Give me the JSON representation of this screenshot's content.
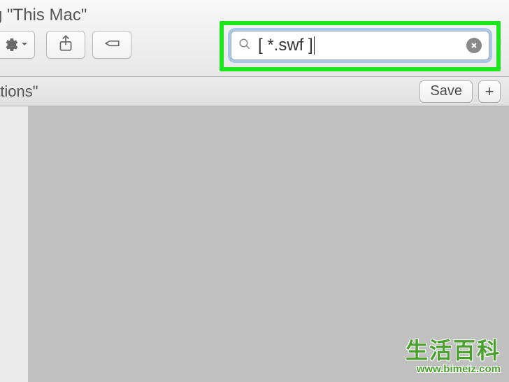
{
  "title_fragment": "g \"This Mac\"",
  "search": {
    "value": "[ *.swf ]"
  },
  "scope": {
    "label_fragment": "ations\"",
    "save_label": "Save"
  },
  "watermark": {
    "chinese": "生活百科",
    "url": "www.bimeiz.com"
  }
}
